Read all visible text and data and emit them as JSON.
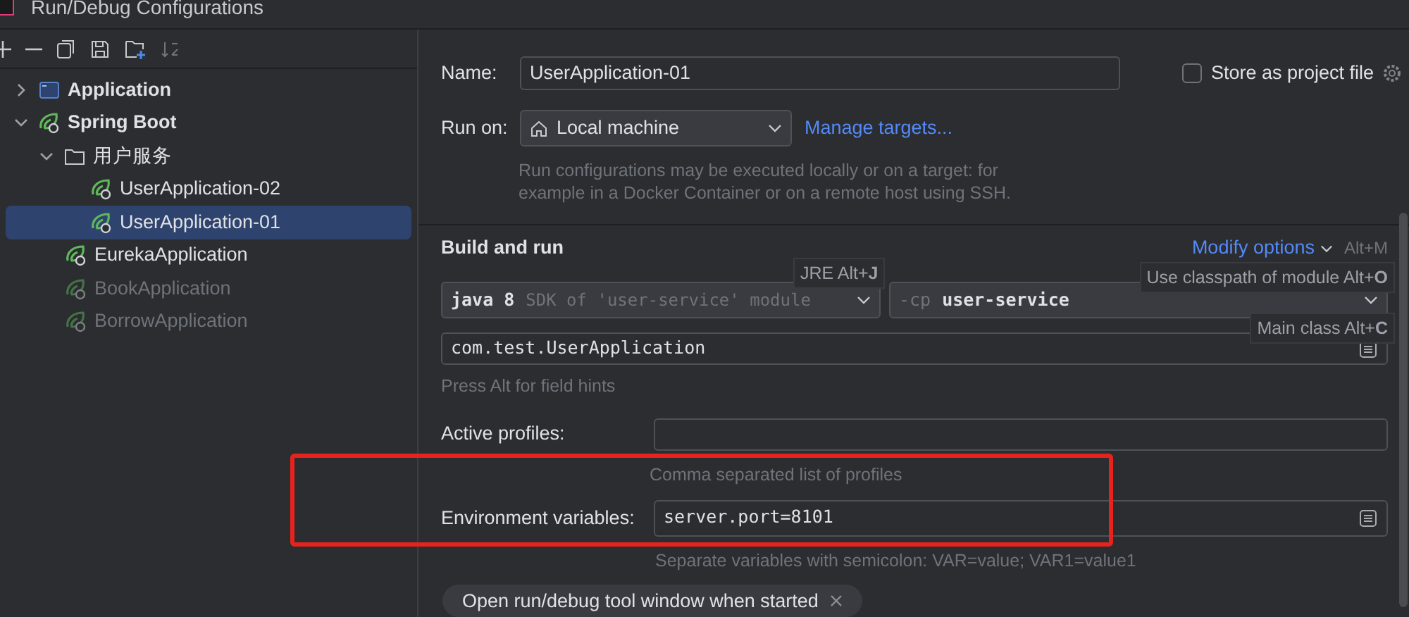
{
  "window": {
    "title": "Run/Debug Configurations"
  },
  "tree": [
    {
      "label": "Application",
      "kind": "application",
      "expanded": false,
      "selected": false,
      "disabled": false
    },
    {
      "label": "Spring Boot",
      "kind": "spring",
      "expanded": true,
      "selected": false,
      "disabled": false,
      "children": [
        {
          "label": "用户服务",
          "kind": "folder",
          "expanded": true,
          "selected": false,
          "disabled": false,
          "children": [
            {
              "label": "UserApplication-02",
              "kind": "config",
              "selected": false,
              "disabled": false
            },
            {
              "label": "UserApplication-01",
              "kind": "config",
              "selected": true,
              "disabled": false
            }
          ]
        },
        {
          "label": "EurekaApplication",
          "kind": "config",
          "selected": false,
          "disabled": false
        },
        {
          "label": "BookApplication",
          "kind": "config",
          "selected": false,
          "disabled": true
        },
        {
          "label": "BorrowApplication",
          "kind": "config",
          "selected": false,
          "disabled": true
        }
      ]
    }
  ],
  "form": {
    "name_label": "Name:",
    "name_value": "UserApplication-01",
    "store": {
      "label": "Store as project file",
      "checked": false
    },
    "run_on_label": "Run on:",
    "run_on_value": "Local machine",
    "manage_link": "Manage targets...",
    "run_on_hint": "Run configurations may be executed locally or on a target: for\nexample in a Docker Container or on a remote host using SSH.",
    "section": "Build and run",
    "modify_options": "Modify options",
    "modify_shortcut": "Alt+M",
    "jre": {
      "version": "java 8",
      "detail": "SDK of 'user-service' module"
    },
    "classpath": {
      "prefix": "-cp",
      "value": "user-service"
    },
    "main_class": "com.test.UserApplication",
    "field_hint": "Press Alt for field hints",
    "profiles_label": "Active profiles:",
    "profiles_hint": "Comma separated list of profiles",
    "env_label": "Environment variables:",
    "env_value": "server.port=8101",
    "env_hint": "Separate variables with semicolon: VAR=value; VAR1=value1",
    "chip": "Open run/debug tool window when started"
  },
  "tooltips": [
    "JRE Alt+**J**",
    "Use classpath of module Alt+**O**",
    "Main class Alt+**C**"
  ]
}
